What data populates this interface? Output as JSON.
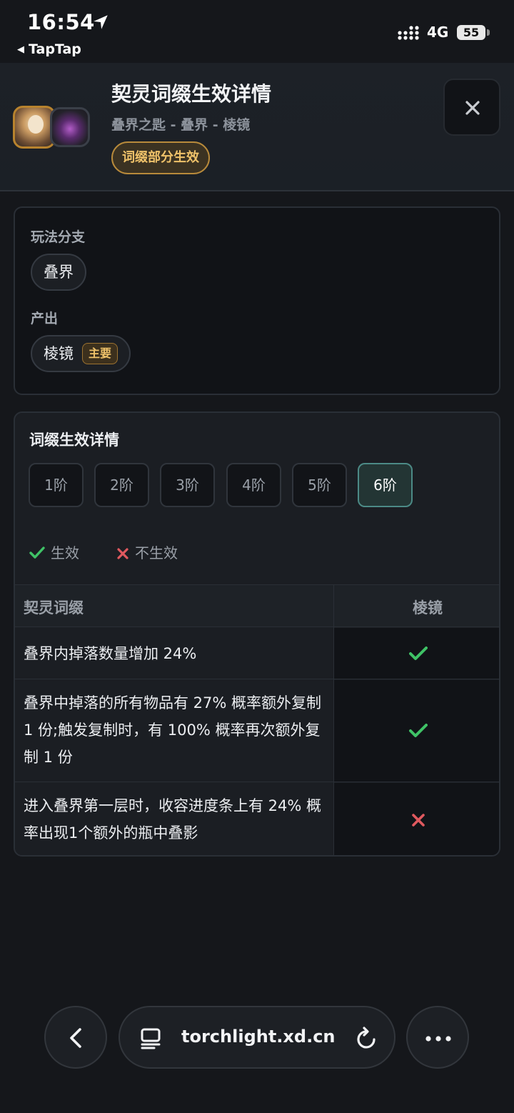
{
  "status_bar": {
    "time": "16:54",
    "back_app": "TapTap",
    "network": "4G",
    "battery": "55"
  },
  "header": {
    "title": "契灵词缀生效详情",
    "subtitle": "叠界之匙 - 叠界 - 棱镜",
    "effect_badge": "词缀部分生效"
  },
  "branch_card": {
    "branch_label": "玩法分支",
    "branch_value": "叠界",
    "output_label": "产出",
    "output_value": "棱镜",
    "output_tag": "主要"
  },
  "details_card": {
    "title": "词缀生效详情",
    "tiers": [
      "1阶",
      "2阶",
      "3阶",
      "4阶",
      "5阶",
      "6阶"
    ],
    "active_tier": "6阶",
    "legend_effective": "生效",
    "legend_ineffective": "不生效",
    "table": {
      "col_affix": "契灵词缀",
      "col_output": "棱镜",
      "rows": [
        {
          "text": "叠界内掉落数量增加 24%",
          "effective": true
        },
        {
          "text": "叠界中掉落的所有物品有 27% 概率额外复制 1 份;触发复制时，有 100% 概率再次额外复制 1 份",
          "effective": true
        },
        {
          "text": "进入叠界第一层时，收容进度条上有 24% 概率出现1个额外的瓶中叠影",
          "effective": false
        }
      ]
    }
  },
  "browser": {
    "url": "torchlight.xd.cn"
  },
  "colors": {
    "effective": "#3fc266",
    "ineffective": "#e0595f",
    "accent_gold": "#efc26a",
    "active_tier": "#4c8a86"
  }
}
